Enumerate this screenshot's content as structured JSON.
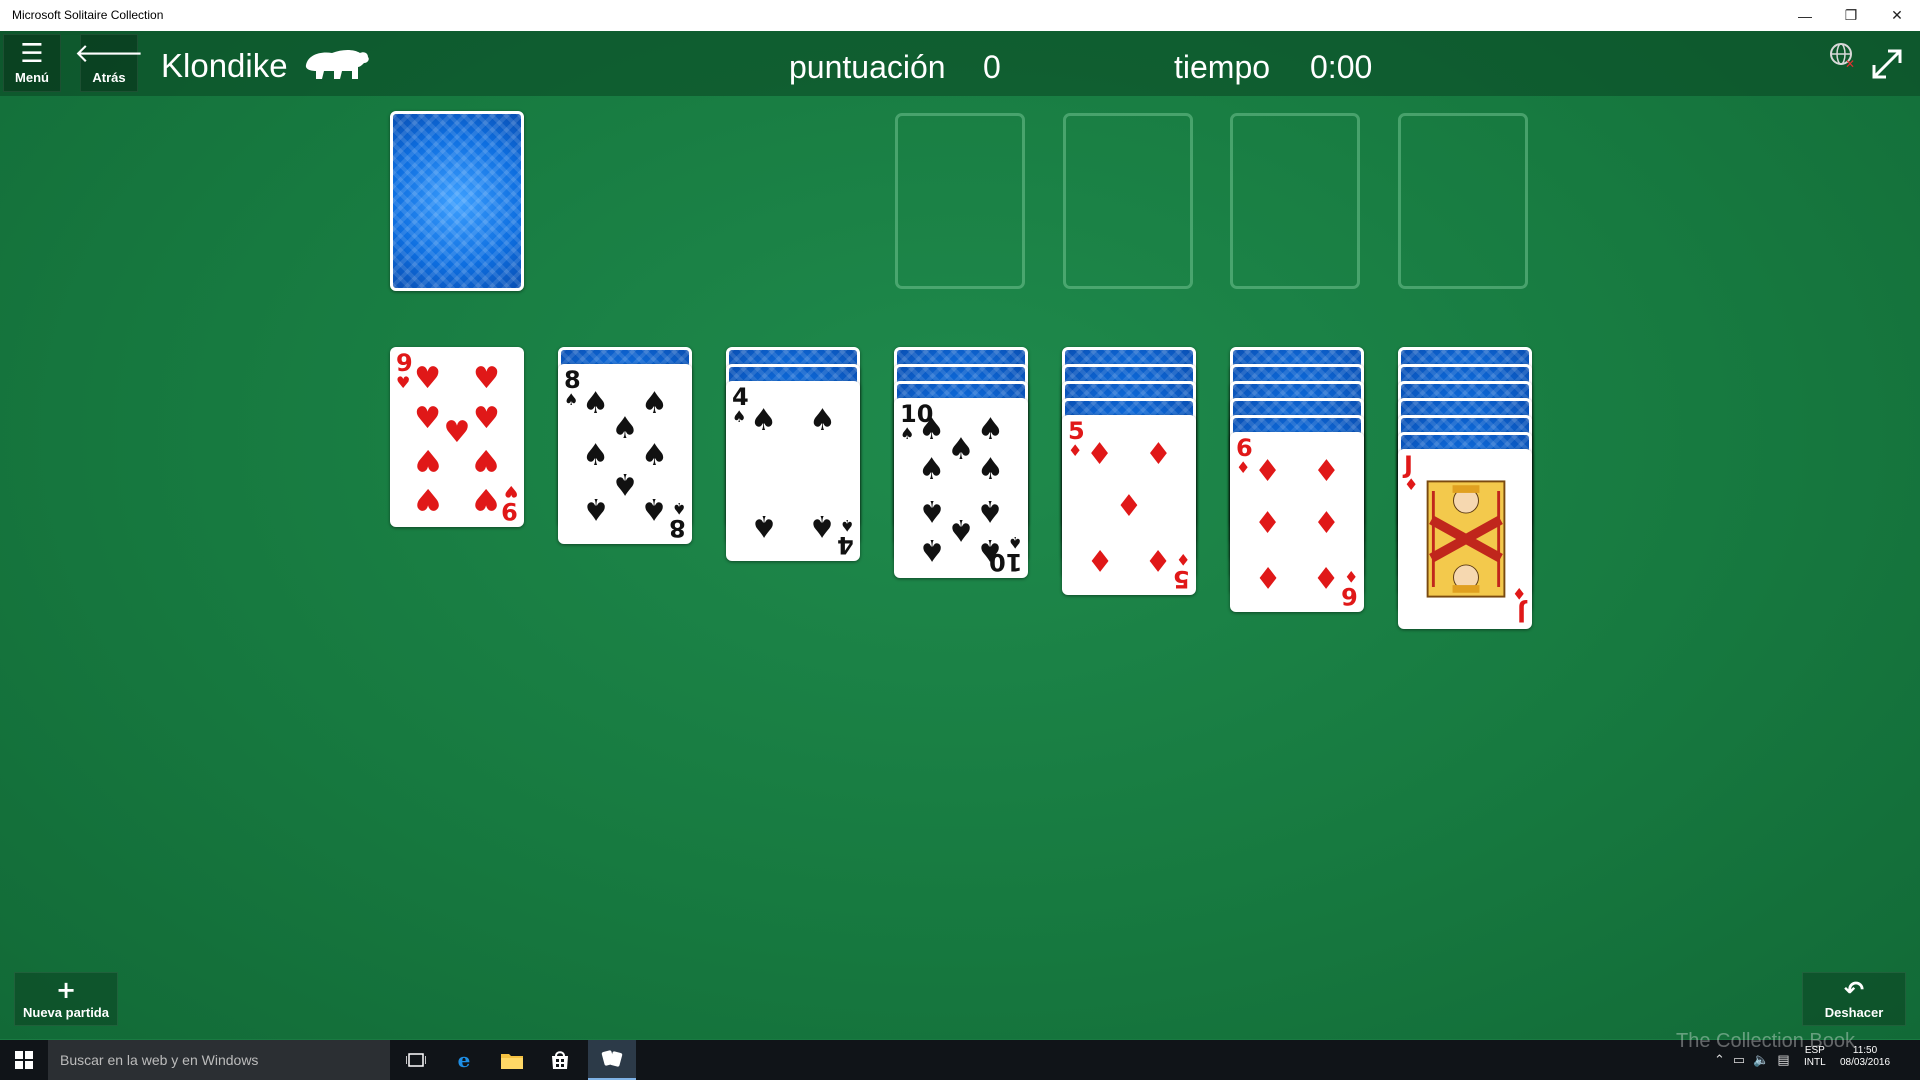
{
  "window": {
    "title": "Microsoft Solitaire Collection",
    "minimize_icon": "—",
    "restore_icon": "❐",
    "close_icon": "✕"
  },
  "topbar": {
    "menu": {
      "icon": "hamburger-icon",
      "label": "Menú"
    },
    "back": {
      "icon": "arrow-left-icon",
      "label": "Atrás"
    },
    "game_title": "Klondike",
    "score_label": "puntuación",
    "score_value": "0",
    "time_label": "tiempo",
    "time_value": "0:00"
  },
  "stock": {
    "face_down": true
  },
  "foundations": [
    {
      "empty": true
    },
    {
      "empty": true
    },
    {
      "empty": true
    },
    {
      "empty": true
    }
  ],
  "tableau": [
    {
      "hidden": 0,
      "top": {
        "rank": "9",
        "suit": "♥",
        "color": "red"
      }
    },
    {
      "hidden": 1,
      "top": {
        "rank": "8",
        "suit": "♠",
        "color": "black"
      }
    },
    {
      "hidden": 2,
      "top": {
        "rank": "4",
        "suit": "♠",
        "color": "black"
      }
    },
    {
      "hidden": 3,
      "top": {
        "rank": "10",
        "suit": "♠",
        "color": "black"
      }
    },
    {
      "hidden": 4,
      "top": {
        "rank": "5",
        "suit": "♦",
        "color": "red"
      }
    },
    {
      "hidden": 5,
      "top": {
        "rank": "6",
        "suit": "♦",
        "color": "red"
      }
    },
    {
      "hidden": 6,
      "top": {
        "rank": "J",
        "suit": "♦",
        "color": "red"
      }
    }
  ],
  "bottom": {
    "new_game": {
      "icon": "plus-icon",
      "label": "Nueva partida"
    },
    "undo": {
      "icon": "undo-icon",
      "label": "Deshacer"
    }
  },
  "taskbar": {
    "search_placeholder": "Buscar en la web y en Windows",
    "lang_top": "ESP",
    "lang_bottom": "INTL",
    "time": "11:50",
    "date": "08/03/2016"
  },
  "watermark": "The Collection Book",
  "colors": {
    "felt": "#1a7a42",
    "card_red": "#e01818",
    "card_back": "#0d6ee0"
  }
}
